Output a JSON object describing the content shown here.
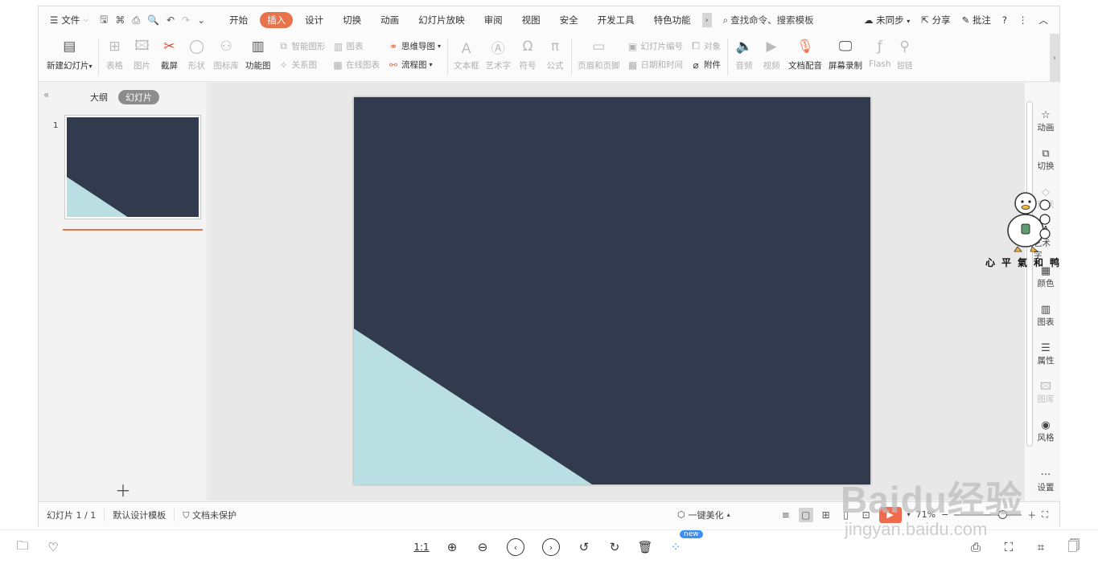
{
  "menubar": {
    "file": "文件",
    "tabs": [
      "开始",
      "插入",
      "设计",
      "切换",
      "动画",
      "幻灯片放映",
      "审阅",
      "视图",
      "安全",
      "开发工具",
      "特色功能"
    ],
    "active_tab": "插入",
    "search": "查找命令、搜索模板",
    "sync": "未同步",
    "share": "分享",
    "comment": "批注"
  },
  "ribbon": {
    "new_slide": "新建幻灯片",
    "table": "表格",
    "picture": "图片",
    "screenshot": "截屏",
    "shape": "形状",
    "icon_lib": "图标库",
    "func_chart": "功能图",
    "smart_art": "智能图形",
    "chart": "图表",
    "relation": "关系图",
    "online_chart": "在线图表",
    "mindmap": "思维导图",
    "flowchart": "流程图",
    "textbox": "文本框",
    "wordart": "艺术字",
    "symbol": "符号",
    "formula": "公式",
    "header_footer": "页眉和页脚",
    "slide_number": "幻灯片编号",
    "object": "对象",
    "date_time": "日期和时间",
    "attachment": "附件",
    "audio": "音频",
    "video": "视频",
    "doc_voice": "文档配音",
    "screen_record": "屏幕录制",
    "flash": "Flash",
    "hyperlink": "超链"
  },
  "left_panel": {
    "outline_tab": "大纲",
    "slides_tab": "幻灯片",
    "slide_number": "1"
  },
  "slide": {
    "background": "#323a4e",
    "accent": "#badfe3"
  },
  "right_sidebar": {
    "animation": "动画",
    "transition": "切换",
    "shape": "形状",
    "wordart": "艺术字",
    "color": "颜色",
    "chart": "图表",
    "property": "属性",
    "gallery": "图库",
    "style": "风格",
    "settings": "设置"
  },
  "status": {
    "slide_count": "幻灯片 1 / 1",
    "template": "默认设计模板",
    "protect": "文档未保护",
    "beautify": "一键美化",
    "zoom": "71%"
  },
  "viewer": {
    "actual_size": "1:1",
    "badge": "new"
  },
  "overlay": {
    "mascot_caption": "心平氣和鸭",
    "watermark_main": "Baidu经验",
    "watermark_sub": "jingyan.baidu.com"
  },
  "colors": {
    "accent_orange": "#e8724a",
    "play_red": "#f06a4d"
  }
}
